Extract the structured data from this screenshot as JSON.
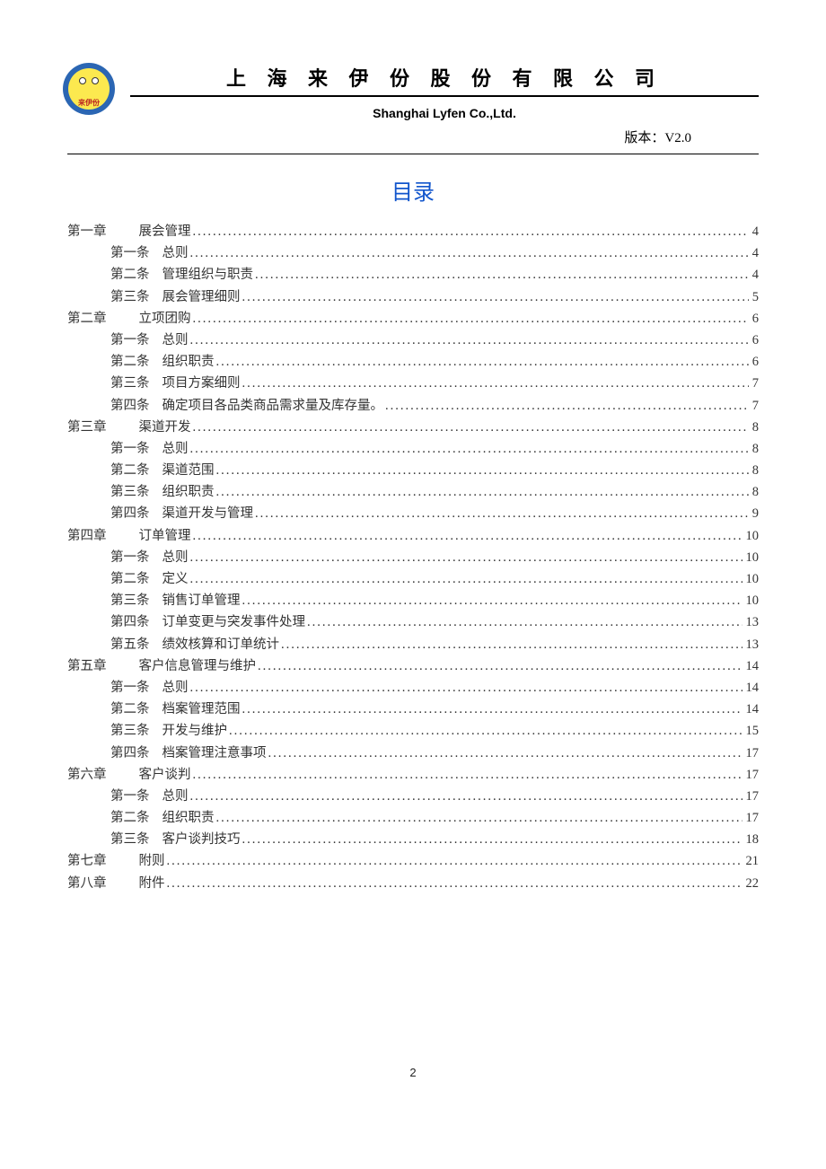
{
  "header": {
    "company_cn": "上 海 来 伊 份 股 份 有 限 公 司",
    "company_en": "Shanghai Lyfen Co.,Ltd.",
    "version_label": "版本：V2.0",
    "logo_text": "来伊份"
  },
  "toc_title": "目录",
  "page_number": "2",
  "toc": [
    {
      "type": "chapter",
      "label": "第一章",
      "text": "展会管理",
      "page": "4"
    },
    {
      "type": "article",
      "label": "第一条",
      "text": "总则",
      "page": "4"
    },
    {
      "type": "article",
      "label": "第二条",
      "text": "管理组织与职责",
      "page": "4"
    },
    {
      "type": "article",
      "label": "第三条",
      "text": "展会管理细则",
      "page": "5"
    },
    {
      "type": "chapter",
      "label": "第二章",
      "text": "立项团购",
      "page": "6"
    },
    {
      "type": "article",
      "label": "第一条",
      "text": "总则",
      "page": "6"
    },
    {
      "type": "article",
      "label": "第二条",
      "text": "组织职责",
      "page": "6"
    },
    {
      "type": "article",
      "label": "第三条",
      "text": "项目方案细则",
      "page": "7"
    },
    {
      "type": "article",
      "label": "第四条",
      "text": "确定项目各品类商品需求量及库存量。",
      "page": "7"
    },
    {
      "type": "chapter",
      "label": "第三章",
      "text": "渠道开发",
      "page": "8"
    },
    {
      "type": "article",
      "label": "第一条",
      "text": "总则",
      "page": "8"
    },
    {
      "type": "article",
      "label": "第二条",
      "text": "渠道范围",
      "page": "8"
    },
    {
      "type": "article",
      "label": "第三条",
      "text": "组织职责",
      "page": "8"
    },
    {
      "type": "article",
      "label": "第四条",
      "text": "渠道开发与管理",
      "page": "9"
    },
    {
      "type": "chapter",
      "label": "第四章",
      "text": "订单管理",
      "page": "10"
    },
    {
      "type": "article",
      "label": "第一条",
      "text": "总则",
      "page": "10"
    },
    {
      "type": "article",
      "label": "第二条",
      "text": "定义",
      "page": "10"
    },
    {
      "type": "article",
      "label": "第三条",
      "text": "销售订单管理",
      "page": "10"
    },
    {
      "type": "article",
      "label": "第四条",
      "text": "订单变更与突发事件处理",
      "page": "13"
    },
    {
      "type": "article",
      "label": "第五条",
      "text": "绩效核算和订单统计",
      "page": "13"
    },
    {
      "type": "chapter",
      "label": "第五章",
      "text": "客户信息管理与维护",
      "page": "14"
    },
    {
      "type": "article",
      "label": "第一条",
      "text": "总则",
      "page": "14"
    },
    {
      "type": "article",
      "label": "第二条",
      "text": "档案管理范围",
      "page": "14"
    },
    {
      "type": "article",
      "label": "第三条",
      "text": "开发与维护",
      "page": "15"
    },
    {
      "type": "article",
      "label": "第四条",
      "text": "档案管理注意事项",
      "page": "17"
    },
    {
      "type": "chapter",
      "label": "第六章",
      "text": "客户谈判",
      "page": "17"
    },
    {
      "type": "article",
      "label": "第一条",
      "text": "总则",
      "page": "17"
    },
    {
      "type": "article",
      "label": "第二条",
      "text": "组织职责",
      "page": "17"
    },
    {
      "type": "article",
      "label": "第三条",
      "text": "客户谈判技巧",
      "page": "18"
    },
    {
      "type": "chapter",
      "label": "第七章",
      "text": "附则",
      "page": "21"
    },
    {
      "type": "chapter",
      "label": "第八章",
      "text": "附件",
      "page": "22"
    }
  ]
}
